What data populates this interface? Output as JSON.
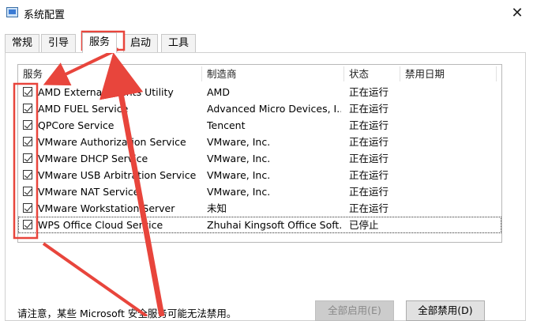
{
  "window": {
    "title": "系统配置"
  },
  "tabs": [
    {
      "label": "常规"
    },
    {
      "label": "引导"
    },
    {
      "label": "服务"
    },
    {
      "label": "启动"
    },
    {
      "label": "工具"
    }
  ],
  "columns": {
    "service": "服务",
    "manufacturer": "制造商",
    "status": "状态",
    "disabled_date": "禁用日期"
  },
  "services": [
    {
      "name": "AMD External Events Utility",
      "manufacturer": "AMD",
      "status": "正在运行",
      "checked": true
    },
    {
      "name": "AMD FUEL Service",
      "manufacturer": "Advanced Micro Devices, I...",
      "status": "正在运行",
      "checked": true
    },
    {
      "name": "QPCore Service",
      "manufacturer": "Tencent",
      "status": "正在运行",
      "checked": true
    },
    {
      "name": "VMware Authorization Service",
      "manufacturer": "VMware, Inc.",
      "status": "正在运行",
      "checked": true
    },
    {
      "name": "VMware DHCP Service",
      "manufacturer": "VMware, Inc.",
      "status": "正在运行",
      "checked": true
    },
    {
      "name": "VMware USB Arbitration Service",
      "manufacturer": "VMware, Inc.",
      "status": "正在运行",
      "checked": true
    },
    {
      "name": "VMware NAT Service",
      "manufacturer": "VMware, Inc.",
      "status": "正在运行",
      "checked": true
    },
    {
      "name": "VMware Workstation Server",
      "manufacturer": "未知",
      "status": "正在运行",
      "checked": true
    },
    {
      "name": "WPS Office Cloud Service",
      "manufacturer": "Zhuhai Kingsoft Office Soft...",
      "status": "已停止",
      "checked": true
    }
  ],
  "footer": {
    "notice": "请注意，某些 Microsoft 安全服务可能无法禁用。",
    "enable_all": "全部启用(E)",
    "disable_all": "全部禁用(D)"
  },
  "colors": {
    "annotation": "#e8453c"
  },
  "icons": {
    "close": "close-icon",
    "app": "system-config-icon"
  }
}
